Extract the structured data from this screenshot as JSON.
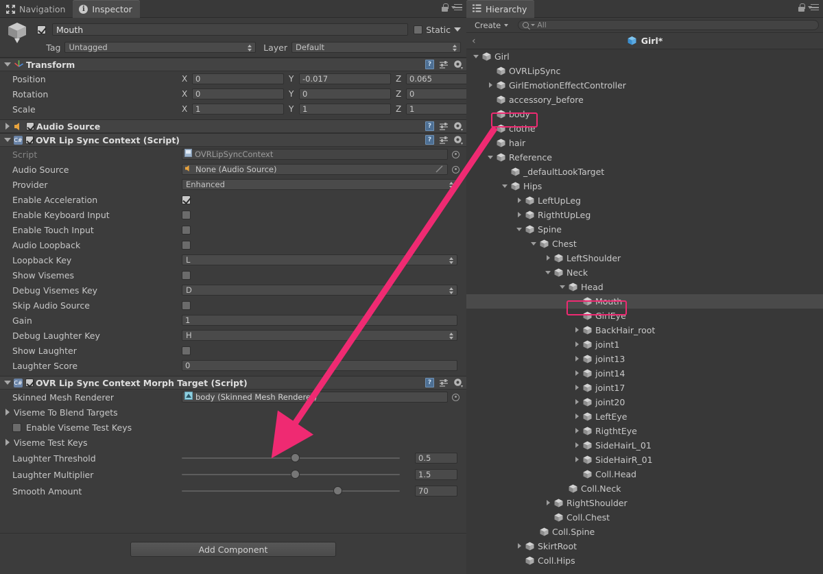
{
  "inspector": {
    "tabs": [
      {
        "label": "Navigation",
        "icon": "navigation-icon",
        "active": false
      },
      {
        "label": "Inspector",
        "icon": "info-icon",
        "active": true
      }
    ],
    "window_icons": [
      "lock-icon",
      "menu-icon"
    ],
    "object": {
      "enabled": true,
      "name": "Mouth",
      "static_label": "Static",
      "static_checked": false,
      "tag_label": "Tag",
      "tag_value": "Untagged",
      "layer_label": "Layer",
      "layer_value": "Default"
    },
    "components": [
      {
        "title": "Transform",
        "icon": "transform-icon",
        "expanded": true,
        "has_toggle": false,
        "rows": [
          {
            "type": "vector3",
            "label": "Position",
            "x": "0",
            "y": "-0.017",
            "z": "0.065"
          },
          {
            "type": "vector3",
            "label": "Rotation",
            "x": "0",
            "y": "0",
            "z": "0"
          },
          {
            "type": "vector3",
            "label": "Scale",
            "x": "1",
            "y": "1",
            "z": "1"
          }
        ]
      },
      {
        "title": "Audio Source",
        "icon": "audio-icon",
        "expanded": false,
        "has_toggle": true,
        "toggle_checked": true,
        "rows": []
      },
      {
        "title": "OVR Lip Sync Context (Script)",
        "icon": "csharp-script-icon",
        "expanded": true,
        "has_toggle": true,
        "toggle_checked": true,
        "rows": [
          {
            "type": "object",
            "label": "Script",
            "value": "OVRLipSyncContext",
            "dim": true,
            "icon": "script-asset-icon"
          },
          {
            "type": "object",
            "label": "Audio Source",
            "value": "None (Audio Source)",
            "icon": "audio-asset-icon"
          },
          {
            "type": "popup",
            "label": "Provider",
            "value": "Enhanced"
          },
          {
            "type": "checkbox",
            "label": "Enable Acceleration",
            "checked": true
          },
          {
            "type": "checkbox",
            "label": "Enable Keyboard Input",
            "checked": false
          },
          {
            "type": "checkbox",
            "label": "Enable Touch Input",
            "checked": false
          },
          {
            "type": "checkbox",
            "label": "Audio Loopback",
            "checked": false
          },
          {
            "type": "popup",
            "label": "Loopback Key",
            "value": "L"
          },
          {
            "type": "checkbox",
            "label": "Show Visemes",
            "checked": false
          },
          {
            "type": "popup",
            "label": "Debug Visemes Key",
            "value": "D"
          },
          {
            "type": "checkbox",
            "label": "Skip Audio Source",
            "checked": false
          },
          {
            "type": "text",
            "label": "Gain",
            "value": "1"
          },
          {
            "type": "popup",
            "label": "Debug Laughter Key",
            "value": "H"
          },
          {
            "type": "checkbox",
            "label": "Show Laughter",
            "checked": false
          },
          {
            "type": "text",
            "label": "Laughter Score",
            "value": "0"
          }
        ]
      },
      {
        "title": "OVR Lip Sync Context Morph Target (Script)",
        "icon": "csharp-script-icon",
        "expanded": true,
        "has_toggle": true,
        "toggle_checked": true,
        "rows": [
          {
            "type": "object",
            "label": "Skinned Mesh Renderer",
            "value": "body (Skinned Mesh Renderer)",
            "icon": "mesh-asset-icon"
          },
          {
            "type": "foldout",
            "label": "Viseme To Blend Targets",
            "expanded": false
          },
          {
            "type": "inline-checkbox",
            "label": "Enable Viseme Test Keys",
            "checked": false
          },
          {
            "type": "foldout",
            "label": "Viseme Test Keys",
            "expanded": false
          },
          {
            "type": "slider",
            "label": "Laughter Threshold",
            "value": "0.5",
            "fill": 0.52
          },
          {
            "type": "slider",
            "label": "Laughter Multiplier",
            "value": "1.5",
            "fill": 0.52
          },
          {
            "type": "slider",
            "label": "Smooth Amount",
            "value": "70",
            "fill": 0.7
          }
        ]
      }
    ],
    "add_component_label": "Add Component"
  },
  "hierarchy": {
    "tab_label": "Hierarchy",
    "tab_icon": "hierarchy-icon",
    "window_icons": [
      "lock-icon",
      "menu-icon"
    ],
    "create_label": "Create",
    "search_placeholder": "All",
    "breadcrumb": {
      "back_icon": "chevron-left-icon",
      "label": "Girl*",
      "icon": "prefab-cube-icon"
    },
    "items": [
      {
        "name": "Girl",
        "depth": 0,
        "fold": "open",
        "selected": false
      },
      {
        "name": "OVRLipSync",
        "depth": 1,
        "fold": "none",
        "selected": false
      },
      {
        "name": "GirlEmotionEffectController",
        "depth": 1,
        "fold": "closed",
        "selected": false
      },
      {
        "name": "accessory_before",
        "depth": 1,
        "fold": "none",
        "selected": false
      },
      {
        "name": "body",
        "depth": 1,
        "fold": "none",
        "selected": false
      },
      {
        "name": "clothe",
        "depth": 1,
        "fold": "none",
        "selected": false
      },
      {
        "name": "hair",
        "depth": 1,
        "fold": "none",
        "selected": false
      },
      {
        "name": "Reference",
        "depth": 1,
        "fold": "open",
        "selected": false
      },
      {
        "name": "_defaultLookTarget",
        "depth": 2,
        "fold": "none",
        "selected": false
      },
      {
        "name": "Hips",
        "depth": 2,
        "fold": "open",
        "selected": false
      },
      {
        "name": "LeftUpLeg",
        "depth": 3,
        "fold": "closed",
        "selected": false
      },
      {
        "name": "RigthtUpLeg",
        "depth": 3,
        "fold": "closed",
        "selected": false
      },
      {
        "name": "Spine",
        "depth": 3,
        "fold": "open",
        "selected": false
      },
      {
        "name": "Chest",
        "depth": 4,
        "fold": "open",
        "selected": false
      },
      {
        "name": "LeftShoulder",
        "depth": 5,
        "fold": "closed",
        "selected": false
      },
      {
        "name": "Neck",
        "depth": 5,
        "fold": "open",
        "selected": false
      },
      {
        "name": "Head",
        "depth": 6,
        "fold": "open",
        "selected": false
      },
      {
        "name": "Mouth",
        "depth": 7,
        "fold": "none",
        "selected": true
      },
      {
        "name": "GirlEye",
        "depth": 7,
        "fold": "none",
        "selected": false
      },
      {
        "name": "BackHair_root",
        "depth": 7,
        "fold": "closed",
        "selected": false
      },
      {
        "name": "joint1",
        "depth": 7,
        "fold": "closed",
        "selected": false
      },
      {
        "name": "joint13",
        "depth": 7,
        "fold": "closed",
        "selected": false
      },
      {
        "name": "joint14",
        "depth": 7,
        "fold": "closed",
        "selected": false
      },
      {
        "name": "joint17",
        "depth": 7,
        "fold": "closed",
        "selected": false
      },
      {
        "name": "joint20",
        "depth": 7,
        "fold": "closed",
        "selected": false
      },
      {
        "name": "LeftEye",
        "depth": 7,
        "fold": "closed",
        "selected": false
      },
      {
        "name": "RigthtEye",
        "depth": 7,
        "fold": "closed",
        "selected": false
      },
      {
        "name": "SideHairL_01",
        "depth": 7,
        "fold": "closed",
        "selected": false
      },
      {
        "name": "SideHairR_01",
        "depth": 7,
        "fold": "closed",
        "selected": false
      },
      {
        "name": "Coll.Head",
        "depth": 7,
        "fold": "none",
        "selected": false
      },
      {
        "name": "Coll.Neck",
        "depth": 6,
        "fold": "none",
        "selected": false
      },
      {
        "name": "RightShoulder",
        "depth": 5,
        "fold": "closed",
        "selected": false
      },
      {
        "name": "Coll.Chest",
        "depth": 5,
        "fold": "none",
        "selected": false
      },
      {
        "name": "Coll.Spine",
        "depth": 4,
        "fold": "none",
        "selected": false
      },
      {
        "name": "SkirtRoot",
        "depth": 3,
        "fold": "closed",
        "selected": false
      },
      {
        "name": "Coll.Hips",
        "depth": 3,
        "fold": "none",
        "selected": false
      }
    ]
  },
  "annotations": {
    "accent_color": "#ef2a72",
    "boxes": [
      {
        "name": "body-callout-box"
      },
      {
        "name": "mouth-callout-box"
      }
    ],
    "arrow": {
      "name": "callout-arrow",
      "from": "body-row",
      "to": "skinned-mesh-renderer-field"
    }
  }
}
